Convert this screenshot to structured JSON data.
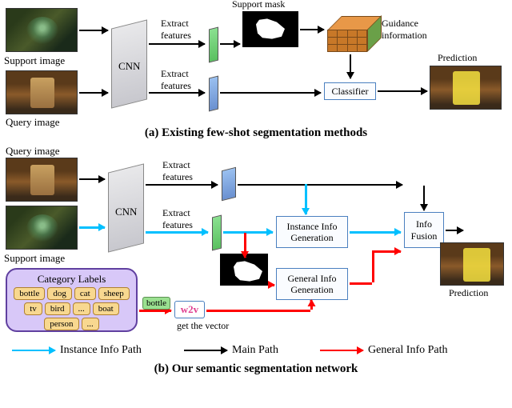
{
  "panel_a": {
    "caption": "(a) Existing few-shot segmentation methods",
    "support_label": "Support image",
    "query_label": "Query image",
    "cnn_label": "CNN",
    "extract1": "Extract\nfeatures",
    "extract2": "Extract\nfeatures",
    "support_mask": "Support mask",
    "guidance": "Guidance\ninformation",
    "classifier": "Classifier",
    "prediction": "Prediction"
  },
  "panel_b": {
    "caption": "(b) Our semantic segmentation network",
    "query_label": "Query image",
    "support_label": "Support image",
    "cnn_label": "CNN",
    "extract1": "Extract\nfeatures",
    "extract2": "Extract\nfeatures",
    "inst_box": "Instance Info\nGeneration",
    "gen_box": "General Info\nGeneration",
    "fusion_box": "Info\nFusion",
    "prediction": "Prediction",
    "cat_title": "Category Labels",
    "cat_items": [
      "bottle",
      "dog",
      "cat",
      "sheep",
      "tv",
      "bird",
      "...",
      "boat",
      "person",
      "..."
    ],
    "sel_cat": "bottle",
    "w2v": "w2v",
    "get_vec": "get the vector"
  },
  "legend": {
    "instance": "Instance Info Path",
    "main": "Main Path",
    "general": "General Info Path"
  }
}
